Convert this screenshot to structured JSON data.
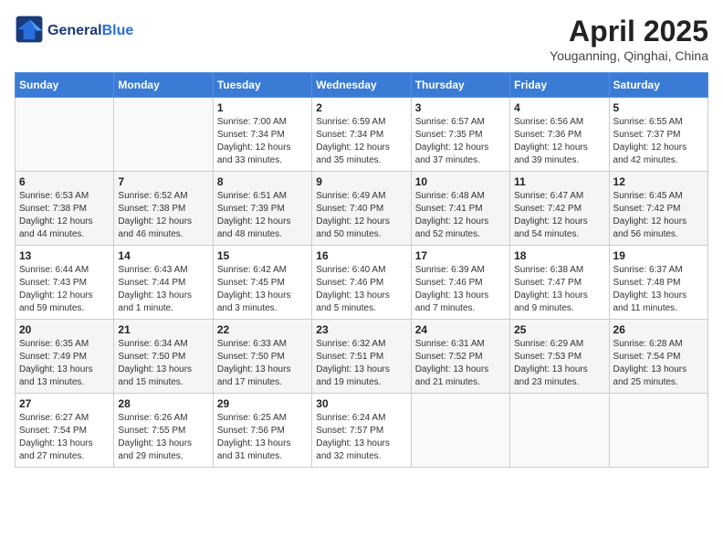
{
  "header": {
    "logo_text_general": "General",
    "logo_text_blue": "Blue",
    "month_title": "April 2025",
    "subtitle": "Youganning, Qinghai, China"
  },
  "weekdays": [
    "Sunday",
    "Monday",
    "Tuesday",
    "Wednesday",
    "Thursday",
    "Friday",
    "Saturday"
  ],
  "weeks": [
    [
      {
        "day": "",
        "sunrise": "",
        "sunset": "",
        "daylight": ""
      },
      {
        "day": "",
        "sunrise": "",
        "sunset": "",
        "daylight": ""
      },
      {
        "day": "1",
        "sunrise": "Sunrise: 7:00 AM",
        "sunset": "Sunset: 7:34 PM",
        "daylight": "Daylight: 12 hours and 33 minutes."
      },
      {
        "day": "2",
        "sunrise": "Sunrise: 6:59 AM",
        "sunset": "Sunset: 7:34 PM",
        "daylight": "Daylight: 12 hours and 35 minutes."
      },
      {
        "day": "3",
        "sunrise": "Sunrise: 6:57 AM",
        "sunset": "Sunset: 7:35 PM",
        "daylight": "Daylight: 12 hours and 37 minutes."
      },
      {
        "day": "4",
        "sunrise": "Sunrise: 6:56 AM",
        "sunset": "Sunset: 7:36 PM",
        "daylight": "Daylight: 12 hours and 39 minutes."
      },
      {
        "day": "5",
        "sunrise": "Sunrise: 6:55 AM",
        "sunset": "Sunset: 7:37 PM",
        "daylight": "Daylight: 12 hours and 42 minutes."
      }
    ],
    [
      {
        "day": "6",
        "sunrise": "Sunrise: 6:53 AM",
        "sunset": "Sunset: 7:38 PM",
        "daylight": "Daylight: 12 hours and 44 minutes."
      },
      {
        "day": "7",
        "sunrise": "Sunrise: 6:52 AM",
        "sunset": "Sunset: 7:38 PM",
        "daylight": "Daylight: 12 hours and 46 minutes."
      },
      {
        "day": "8",
        "sunrise": "Sunrise: 6:51 AM",
        "sunset": "Sunset: 7:39 PM",
        "daylight": "Daylight: 12 hours and 48 minutes."
      },
      {
        "day": "9",
        "sunrise": "Sunrise: 6:49 AM",
        "sunset": "Sunset: 7:40 PM",
        "daylight": "Daylight: 12 hours and 50 minutes."
      },
      {
        "day": "10",
        "sunrise": "Sunrise: 6:48 AM",
        "sunset": "Sunset: 7:41 PM",
        "daylight": "Daylight: 12 hours and 52 minutes."
      },
      {
        "day": "11",
        "sunrise": "Sunrise: 6:47 AM",
        "sunset": "Sunset: 7:42 PM",
        "daylight": "Daylight: 12 hours and 54 minutes."
      },
      {
        "day": "12",
        "sunrise": "Sunrise: 6:45 AM",
        "sunset": "Sunset: 7:42 PM",
        "daylight": "Daylight: 12 hours and 56 minutes."
      }
    ],
    [
      {
        "day": "13",
        "sunrise": "Sunrise: 6:44 AM",
        "sunset": "Sunset: 7:43 PM",
        "daylight": "Daylight: 12 hours and 59 minutes."
      },
      {
        "day": "14",
        "sunrise": "Sunrise: 6:43 AM",
        "sunset": "Sunset: 7:44 PM",
        "daylight": "Daylight: 13 hours and 1 minute."
      },
      {
        "day": "15",
        "sunrise": "Sunrise: 6:42 AM",
        "sunset": "Sunset: 7:45 PM",
        "daylight": "Daylight: 13 hours and 3 minutes."
      },
      {
        "day": "16",
        "sunrise": "Sunrise: 6:40 AM",
        "sunset": "Sunset: 7:46 PM",
        "daylight": "Daylight: 13 hours and 5 minutes."
      },
      {
        "day": "17",
        "sunrise": "Sunrise: 6:39 AM",
        "sunset": "Sunset: 7:46 PM",
        "daylight": "Daylight: 13 hours and 7 minutes."
      },
      {
        "day": "18",
        "sunrise": "Sunrise: 6:38 AM",
        "sunset": "Sunset: 7:47 PM",
        "daylight": "Daylight: 13 hours and 9 minutes."
      },
      {
        "day": "19",
        "sunrise": "Sunrise: 6:37 AM",
        "sunset": "Sunset: 7:48 PM",
        "daylight": "Daylight: 13 hours and 11 minutes."
      }
    ],
    [
      {
        "day": "20",
        "sunrise": "Sunrise: 6:35 AM",
        "sunset": "Sunset: 7:49 PM",
        "daylight": "Daylight: 13 hours and 13 minutes."
      },
      {
        "day": "21",
        "sunrise": "Sunrise: 6:34 AM",
        "sunset": "Sunset: 7:50 PM",
        "daylight": "Daylight: 13 hours and 15 minutes."
      },
      {
        "day": "22",
        "sunrise": "Sunrise: 6:33 AM",
        "sunset": "Sunset: 7:50 PM",
        "daylight": "Daylight: 13 hours and 17 minutes."
      },
      {
        "day": "23",
        "sunrise": "Sunrise: 6:32 AM",
        "sunset": "Sunset: 7:51 PM",
        "daylight": "Daylight: 13 hours and 19 minutes."
      },
      {
        "day": "24",
        "sunrise": "Sunrise: 6:31 AM",
        "sunset": "Sunset: 7:52 PM",
        "daylight": "Daylight: 13 hours and 21 minutes."
      },
      {
        "day": "25",
        "sunrise": "Sunrise: 6:29 AM",
        "sunset": "Sunset: 7:53 PM",
        "daylight": "Daylight: 13 hours and 23 minutes."
      },
      {
        "day": "26",
        "sunrise": "Sunrise: 6:28 AM",
        "sunset": "Sunset: 7:54 PM",
        "daylight": "Daylight: 13 hours and 25 minutes."
      }
    ],
    [
      {
        "day": "27",
        "sunrise": "Sunrise: 6:27 AM",
        "sunset": "Sunset: 7:54 PM",
        "daylight": "Daylight: 13 hours and 27 minutes."
      },
      {
        "day": "28",
        "sunrise": "Sunrise: 6:26 AM",
        "sunset": "Sunset: 7:55 PM",
        "daylight": "Daylight: 13 hours and 29 minutes."
      },
      {
        "day": "29",
        "sunrise": "Sunrise: 6:25 AM",
        "sunset": "Sunset: 7:56 PM",
        "daylight": "Daylight: 13 hours and 31 minutes."
      },
      {
        "day": "30",
        "sunrise": "Sunrise: 6:24 AM",
        "sunset": "Sunset: 7:57 PM",
        "daylight": "Daylight: 13 hours and 32 minutes."
      },
      {
        "day": "",
        "sunrise": "",
        "sunset": "",
        "daylight": ""
      },
      {
        "day": "",
        "sunrise": "",
        "sunset": "",
        "daylight": ""
      },
      {
        "day": "",
        "sunrise": "",
        "sunset": "",
        "daylight": ""
      }
    ]
  ]
}
